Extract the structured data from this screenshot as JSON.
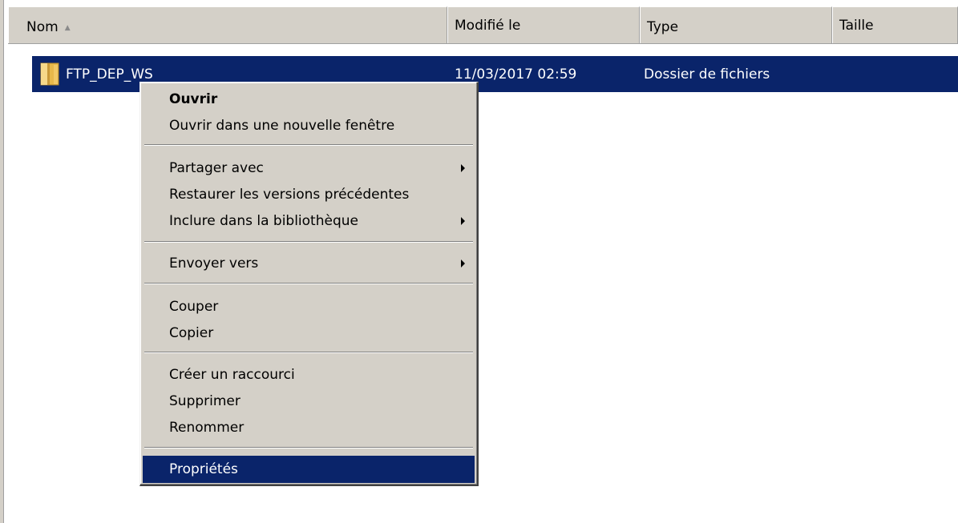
{
  "columns": {
    "name": "Nom",
    "modified": "Modifié le",
    "type": "Type",
    "size": "Taille"
  },
  "file": {
    "name": "FTP_DEP_WS",
    "modified": "11/03/2017 02:59",
    "type": "Dossier de fichiers",
    "icon": "folder-icon",
    "selected": true
  },
  "context_menu": {
    "open": "Ouvrir",
    "open_new_window": "Ouvrir dans une nouvelle fenêtre",
    "share_with": "Partager avec",
    "restore_versions": "Restaurer les versions précédentes",
    "include_library": "Inclure dans la bibliothèque",
    "send_to": "Envoyer vers",
    "cut": "Couper",
    "copy": "Copier",
    "create_shortcut": "Créer un raccourci",
    "delete": "Supprimer",
    "rename": "Renommer",
    "properties": "Propriétés",
    "highlighted_item": "Propriétés"
  },
  "colors": {
    "selection": "#0a246a",
    "menu_bg": "#d4d0c8",
    "header_bg": "#d4d0c8"
  }
}
